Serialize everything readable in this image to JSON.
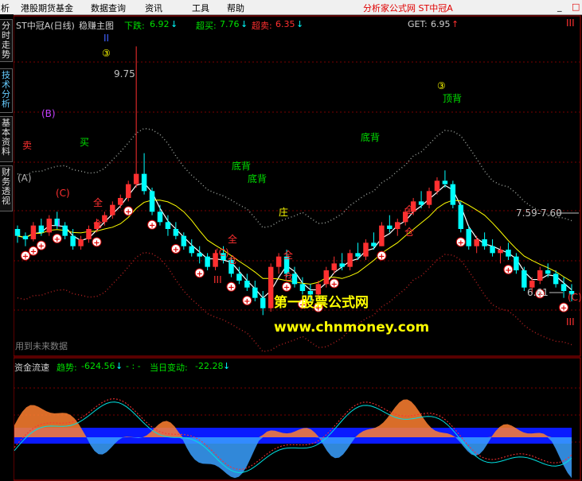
{
  "menu": {
    "items": [
      "析",
      "港股期货基金",
      "数据查询",
      "资讯",
      "工具",
      "帮助"
    ],
    "app_title": "分析家公式网 ST中冠A",
    "win_buttons": [
      "_",
      "□"
    ]
  },
  "side_tabs": [
    {
      "label": "分时走势",
      "active": false
    },
    {
      "label": "技术分析",
      "active": true
    },
    {
      "label": "基本资料",
      "active": false
    },
    {
      "label": "财务透视",
      "active": false
    }
  ],
  "main_header": {
    "stock": "ST中冠A(日线)",
    "indicator": "稳赚主图",
    "down_label": "下跌:",
    "down_value": "6.92",
    "overbought_label": "超买:",
    "overbought_value": "7.76",
    "oversold_label": "超卖:",
    "oversold_value": "6.35",
    "get_label": "GET:",
    "get_value": "6.95",
    "arrow_down": "↓",
    "arrow_up": "↑"
  },
  "watermark": {
    "line1": "第一股票公式网",
    "line2": "www.chnmoney.com"
  },
  "future_data_label": "用到未来数据",
  "sub_header": {
    "name": "资金流速",
    "trend_label": "趋势:",
    "trend_value": "-624.56",
    "sep": "- : -",
    "today_label": "当日变动:",
    "today_value": "-22.28"
  },
  "colors": {
    "up": "#ff3030",
    "down": "#00ffff",
    "yellow": "#ffff00",
    "green": "#00e000",
    "dot_gray": "#9aa09a",
    "dot_red": "#b02020",
    "accent_red": "#e00000",
    "blue_area": "#0a1aff",
    "light_blue": "#3aa0ff",
    "orange": "#ff8030"
  },
  "chart_data": {
    "type": "candlestick",
    "series_name": "ST中冠A",
    "ohlc": [
      [
        7.1,
        7.15,
        6.9,
        7.0
      ],
      [
        7.0,
        7.05,
        6.85,
        6.95
      ],
      [
        6.95,
        7.2,
        6.92,
        7.15
      ],
      [
        7.15,
        7.25,
        7.0,
        7.05
      ],
      [
        7.05,
        7.3,
        7.0,
        7.25
      ],
      [
        7.25,
        7.35,
        7.1,
        7.15
      ],
      [
        7.15,
        7.2,
        6.95,
        7.0
      ],
      [
        7.0,
        7.1,
        6.8,
        6.85
      ],
      [
        6.85,
        7.0,
        6.8,
        6.95
      ],
      [
        6.95,
        7.15,
        6.9,
        7.1
      ],
      [
        7.1,
        7.25,
        7.05,
        7.2
      ],
      [
        7.2,
        7.35,
        7.15,
        7.3
      ],
      [
        7.3,
        7.5,
        7.25,
        7.45
      ],
      [
        7.45,
        7.6,
        7.4,
        7.55
      ],
      [
        7.55,
        7.8,
        7.5,
        7.75
      ],
      [
        7.75,
        9.75,
        7.7,
        7.9
      ],
      [
        7.9,
        8.2,
        7.6,
        7.65
      ],
      [
        7.65,
        7.7,
        7.3,
        7.35
      ],
      [
        7.35,
        7.45,
        7.15,
        7.2
      ],
      [
        7.2,
        7.3,
        7.0,
        7.1
      ],
      [
        7.1,
        7.2,
        6.95,
        7.0
      ],
      [
        7.0,
        7.05,
        6.8,
        6.85
      ],
      [
        6.85,
        6.95,
        6.7,
        6.75
      ],
      [
        6.75,
        6.85,
        6.6,
        6.7
      ],
      [
        6.7,
        6.75,
        6.5,
        6.55
      ],
      [
        6.55,
        6.8,
        6.5,
        6.75
      ],
      [
        6.75,
        6.85,
        6.6,
        6.65
      ],
      [
        6.65,
        6.7,
        6.4,
        6.45
      ],
      [
        6.45,
        6.55,
        6.3,
        6.35
      ],
      [
        6.35,
        6.45,
        6.2,
        6.25
      ],
      [
        6.25,
        6.35,
        6.05,
        6.1
      ],
      [
        6.1,
        6.2,
        5.85,
        5.95
      ],
      [
        5.95,
        6.6,
        5.9,
        6.55
      ],
      [
        6.55,
        6.75,
        6.45,
        6.7
      ],
      [
        6.7,
        6.8,
        6.4,
        6.45
      ],
      [
        6.45,
        6.55,
        6.25,
        6.3
      ],
      [
        6.3,
        6.4,
        6.15,
        6.2
      ],
      [
        6.2,
        6.3,
        6.05,
        6.15
      ],
      [
        6.15,
        6.35,
        6.1,
        6.3
      ],
      [
        6.3,
        6.55,
        6.25,
        6.5
      ],
      [
        6.5,
        6.7,
        6.45,
        6.6
      ],
      [
        6.6,
        6.75,
        6.5,
        6.55
      ],
      [
        6.55,
        6.8,
        6.5,
        6.75
      ],
      [
        6.75,
        6.9,
        6.65,
        6.7
      ],
      [
        6.7,
        6.95,
        6.65,
        6.9
      ],
      [
        6.9,
        7.05,
        6.8,
        6.85
      ],
      [
        6.85,
        7.2,
        6.85,
        7.15
      ],
      [
        7.15,
        7.3,
        7.05,
        7.1
      ],
      [
        7.1,
        7.25,
        7.0,
        7.2
      ],
      [
        7.2,
        7.4,
        7.15,
        7.35
      ],
      [
        7.35,
        7.55,
        7.3,
        7.5
      ],
      [
        7.5,
        7.65,
        7.4,
        7.45
      ],
      [
        7.45,
        7.7,
        7.4,
        7.65
      ],
      [
        7.65,
        7.85,
        7.6,
        7.8
      ],
      [
        7.8,
        7.95,
        7.7,
        7.75
      ],
      [
        7.75,
        7.8,
        7.4,
        7.45
      ],
      [
        7.45,
        7.5,
        7.05,
        7.1
      ],
      [
        7.1,
        7.15,
        6.8,
        6.85
      ],
      [
        6.85,
        7.0,
        6.75,
        6.95
      ],
      [
        6.95,
        7.05,
        6.8,
        6.85
      ],
      [
        6.85,
        6.95,
        6.7,
        6.75
      ],
      [
        6.75,
        6.85,
        6.6,
        6.8
      ],
      [
        6.8,
        6.9,
        6.65,
        6.7
      ],
      [
        6.7,
        6.75,
        6.45,
        6.5
      ],
      [
        6.5,
        6.55,
        6.2,
        6.25
      ],
      [
        6.25,
        6.4,
        6.15,
        6.35
      ],
      [
        6.35,
        6.55,
        6.3,
        6.5
      ],
      [
        6.5,
        6.6,
        6.4,
        6.45
      ],
      [
        6.45,
        6.5,
        6.25,
        6.3
      ],
      [
        6.3,
        6.4,
        6.1,
        6.2
      ],
      [
        6.2,
        6.3,
        6.05,
        6.15
      ]
    ],
    "labels": [
      {
        "text": "9.75",
        "color": "#c0c0c0"
      },
      {
        "text": "7.59-7.60",
        "color": "#c0c0c0"
      },
      {
        "text": "6.61",
        "color": "#c0c0c0"
      },
      {
        "text": "(A)",
        "color": "#b0b0b0"
      },
      {
        "text": "(B)",
        "color": "#c040ff"
      },
      {
        "text": "(C)",
        "color": "#ff3030"
      },
      {
        "text": "(C)",
        "color": "#ff3030"
      },
      {
        "text": "(C)",
        "color": "#ff3030"
      },
      {
        "text": "I",
        "color": "#c040ff"
      },
      {
        "text": "II",
        "color": "#4060ff"
      },
      {
        "text": "III",
        "color": "#ff3030"
      },
      {
        "text": "III",
        "color": "#ff3030"
      },
      {
        "text": "III",
        "color": "#ff3030"
      },
      {
        "text": "③",
        "color": "#ffff00"
      },
      {
        "text": "③",
        "color": "#ffff00"
      },
      {
        "text": "顶背",
        "color": "#00e000"
      },
      {
        "text": "底背",
        "color": "#00e000"
      },
      {
        "text": "底背",
        "color": "#00e000"
      },
      {
        "text": "底背",
        "color": "#00e000"
      },
      {
        "text": "全",
        "color": "#ff3030"
      },
      {
        "text": "仓",
        "color": "#ff3030"
      },
      {
        "text": "全",
        "color": "#ff3030"
      },
      {
        "text": "仓",
        "color": "#ff3030"
      },
      {
        "text": "全",
        "color": "#ff3030"
      },
      {
        "text": "仓",
        "color": "#ff3030"
      },
      {
        "text": "全",
        "color": "#ff3030"
      },
      {
        "text": "仓",
        "color": "#ff3030"
      },
      {
        "text": "买",
        "color": "#00e000"
      },
      {
        "text": "卖",
        "color": "#ff3030"
      },
      {
        "text": "庄",
        "color": "#ffff00"
      }
    ],
    "ylim": [
      5.6,
      10.1
    ],
    "sub_chart": {
      "name": "资金流速",
      "trend": -624.56,
      "today_change": -22.28
    }
  }
}
